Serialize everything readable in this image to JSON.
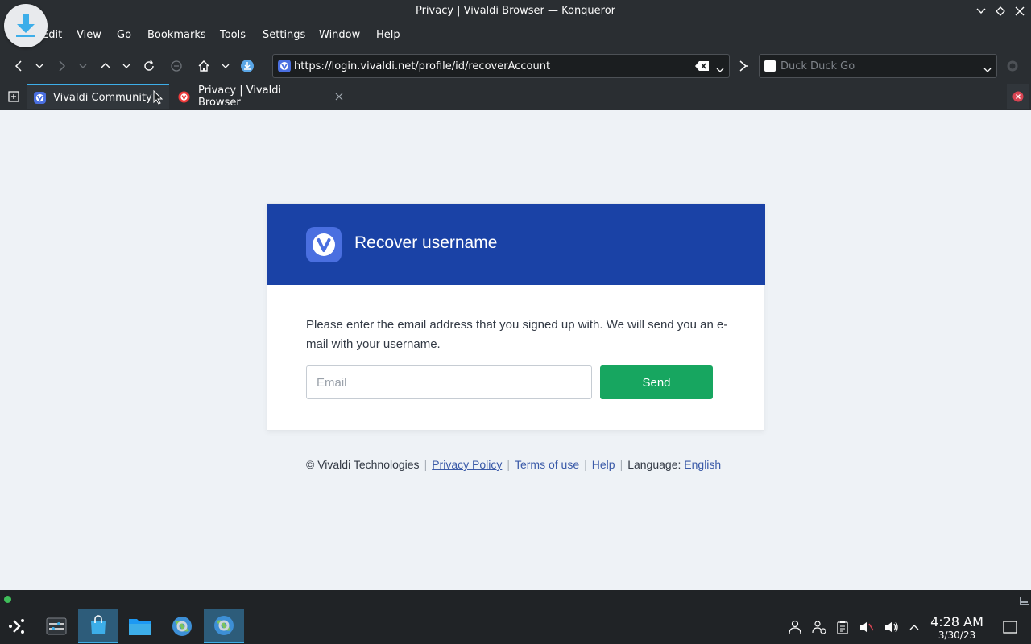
{
  "window": {
    "title": "Privacy | Vivaldi Browser — Konqueror"
  },
  "menu": [
    "Edit",
    "View",
    "Go",
    "Bookmarks",
    "Tools",
    "Settings",
    "Window",
    "Help"
  ],
  "nav": {
    "url": "https://login.vivaldi.net/profile/id/recoverAccount",
    "search_placeholder": "Duck Duck Go"
  },
  "tabs": [
    {
      "label": "Vivaldi Community",
      "active": true
    },
    {
      "label": "Privacy | Vivaldi Browser",
      "active": false
    }
  ],
  "page": {
    "card_title": "Recover username",
    "description": "Please enter the email address that you signed up with. We will send you an e-mail with your username.",
    "email_placeholder": "Email",
    "send_label": "Send",
    "footer": {
      "copyright": "© Vivaldi Technologies",
      "privacy": "Privacy Policy",
      "terms": "Terms of use",
      "help": "Help",
      "language_label": "Language:",
      "language_value": "English"
    }
  },
  "taskbar": {
    "time": "4:28 AM",
    "date": "3/30/23"
  },
  "colors": {
    "header_blue": "#1a42a6",
    "send_green": "#17a660",
    "accent": "#3daee9"
  }
}
